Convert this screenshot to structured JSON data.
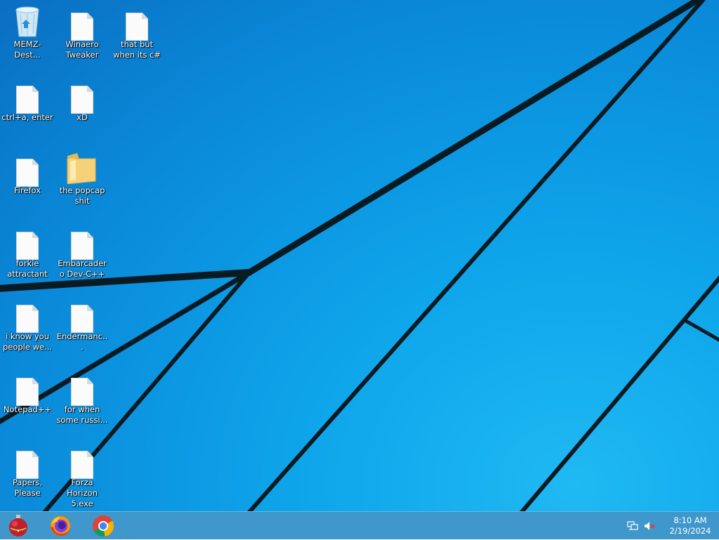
{
  "desktop": {
    "icons": [
      {
        "label": "MEMZ-Dest...",
        "icon": "recycle-bin-icon"
      },
      {
        "label": "Winaero Tweaker",
        "icon": "document-icon"
      },
      {
        "label": "that but when its c#",
        "icon": "document-icon"
      },
      {
        "label": "ctrl+a, enter",
        "icon": "document-icon"
      },
      {
        "label": "xD",
        "icon": "document-icon"
      },
      {
        "label": "Firefox",
        "icon": "document-icon"
      },
      {
        "label": "the popcap shit",
        "icon": "folder-icon"
      },
      {
        "label": "forkie attractant",
        "icon": "document-icon"
      },
      {
        "label": "Embarcadero Dev-C++",
        "icon": "document-icon"
      },
      {
        "label": "i know you people we...",
        "icon": "document-icon"
      },
      {
        "label": "Endermanc...",
        "icon": "document-icon"
      },
      {
        "label": "Notepad++",
        "icon": "document-icon"
      },
      {
        "label": "for when some russi...",
        "icon": "document-icon"
      },
      {
        "label": "Papers, Please",
        "icon": "document-icon"
      },
      {
        "label": "Forza Horizon 5.exe",
        "icon": "document-icon"
      }
    ]
  },
  "taskbar": {
    "pinned": [
      {
        "name": "start-orb",
        "icon": "christmas-ornament-icon"
      },
      {
        "name": "firefox",
        "icon": "firefox-icon"
      },
      {
        "name": "chrome",
        "icon": "chrome-icon"
      }
    ],
    "tray": {
      "network_icon": "network-icon",
      "volume_icon": "volume-muted-icon"
    },
    "clock": {
      "time": "8:10 AM",
      "date": "2/19/2024"
    }
  },
  "colors": {
    "wallpaper": "#0ea4ea",
    "taskbar": "#3f97cb",
    "wallpaper_lines": "#0a1a24"
  }
}
